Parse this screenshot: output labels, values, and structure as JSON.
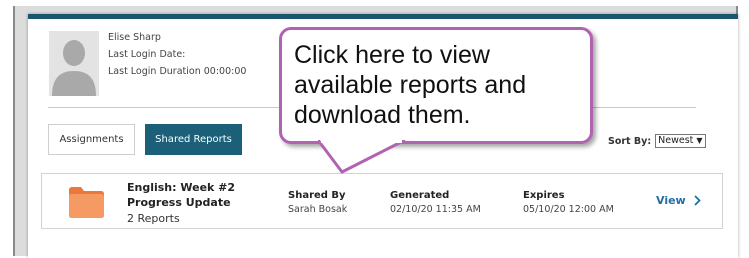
{
  "user": {
    "name": "Elise Sharp",
    "last_login_date": "Last Login Date:",
    "last_login_duration": "Last Login Duration 00:00:00"
  },
  "tabs": {
    "assignments_label": "Assignments",
    "shared_reports_label": "Shared Reports"
  },
  "sort": {
    "label": "Sort By:",
    "selected": "Newest",
    "arrow_icon": "triangle-down-icon"
  },
  "report": {
    "title": "English: Week #2 Progress Update",
    "count": "2 Reports",
    "shared_by_header": "Shared By",
    "shared_by_value": "Sarah Bosak",
    "generated_header": "Generated",
    "generated_value": "02/10/20 11:35 AM",
    "expires_header": "Expires",
    "expires_value": "05/10/20 12:00 AM",
    "view_label": "View",
    "icon": "folder-icon"
  },
  "callout": {
    "text": "Click here to view available reports and download them."
  },
  "colors": {
    "header_bar": "#1a566e",
    "primary_button": "#1b5f78",
    "link": "#1f6fa3",
    "folder": "#f08a4b",
    "callout_border": "#b063b0"
  }
}
